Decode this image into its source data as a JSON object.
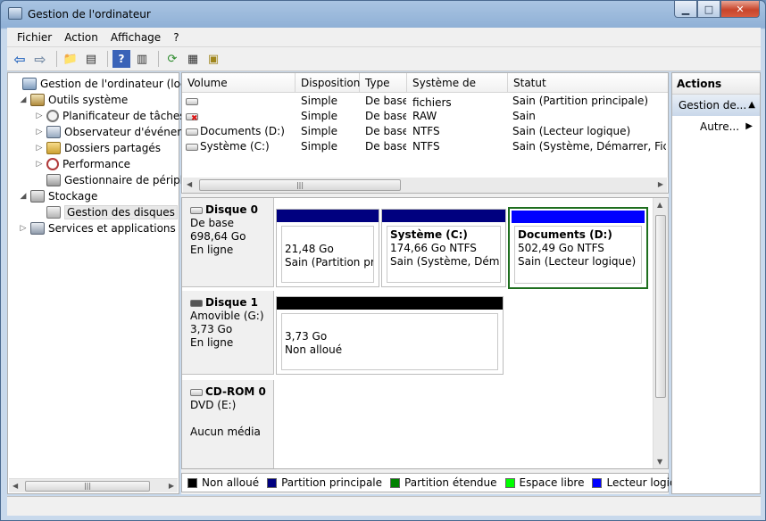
{
  "window": {
    "title": "Gestion de l'ordinateur"
  },
  "menu": [
    "Fichier",
    "Action",
    "Affichage",
    "?"
  ],
  "tree": {
    "root": "Gestion de l'ordinateur (local)",
    "tools": "Outils système",
    "task_scheduler": "Planificateur de tâches",
    "event_viewer": "Observateur d'événeme",
    "shared_folders": "Dossiers partagés",
    "performance": "Performance",
    "device_manager": "Gestionnaire de périphé",
    "storage": "Stockage",
    "disk_management": "Gestion des disques",
    "services": "Services et applications"
  },
  "volumes": {
    "headers": [
      "Volume",
      "Disposition",
      "Type",
      "Système de fichiers",
      "Statut"
    ],
    "rows": [
      {
        "volume": "",
        "layout": "Simple",
        "type": "De base",
        "fs": "",
        "status": "Sain (Partition principale)"
      },
      {
        "volume": "",
        "layout": "Simple",
        "type": "De base",
        "fs": "RAW",
        "status": "Sain"
      },
      {
        "volume": "Documents (D:)",
        "layout": "Simple",
        "type": "De base",
        "fs": "NTFS",
        "status": "Sain (Lecteur logique)"
      },
      {
        "volume": "Système (C:)",
        "layout": "Simple",
        "type": "De base",
        "fs": "NTFS",
        "status": "Sain (Système, Démarrer, Fichier"
      }
    ]
  },
  "disks": [
    {
      "name": "Disque 0",
      "kind": "De base",
      "size": "698,64 Go",
      "state": "En ligne",
      "partitions": [
        {
          "title": "",
          "size": "21,48 Go",
          "status": "Sain (Partition princ"
        },
        {
          "title": "Système  (C:)",
          "size": "174,66 Go NTFS",
          "status": "Sain (Système, Démarrer"
        },
        {
          "title": "Documents  (D:)",
          "size": "502,49 Go NTFS",
          "status": "Sain (Lecteur logique)"
        }
      ]
    },
    {
      "name": "Disque 1",
      "kind": "Amovible (G:)",
      "size": "3,73 Go",
      "state": "En ligne",
      "partitions": [
        {
          "title": "",
          "size": "3,73 Go",
          "status": "Non alloué"
        }
      ]
    },
    {
      "name": "CD-ROM 0",
      "kind": "DVD (E:)",
      "size": "",
      "state": "Aucun média",
      "partitions": []
    }
  ],
  "legend": [
    "Non alloué",
    "Partition principale",
    "Partition étendue",
    "Espace libre",
    "Lecteur logique"
  ],
  "colors": {
    "unallocated": "#000000",
    "primary": "#00007f",
    "extended": "#008000",
    "free": "#00ff00",
    "logical": "#0000ff"
  },
  "actions": {
    "header": "Actions",
    "sub": "Gestion de...",
    "item": "Autre..."
  }
}
